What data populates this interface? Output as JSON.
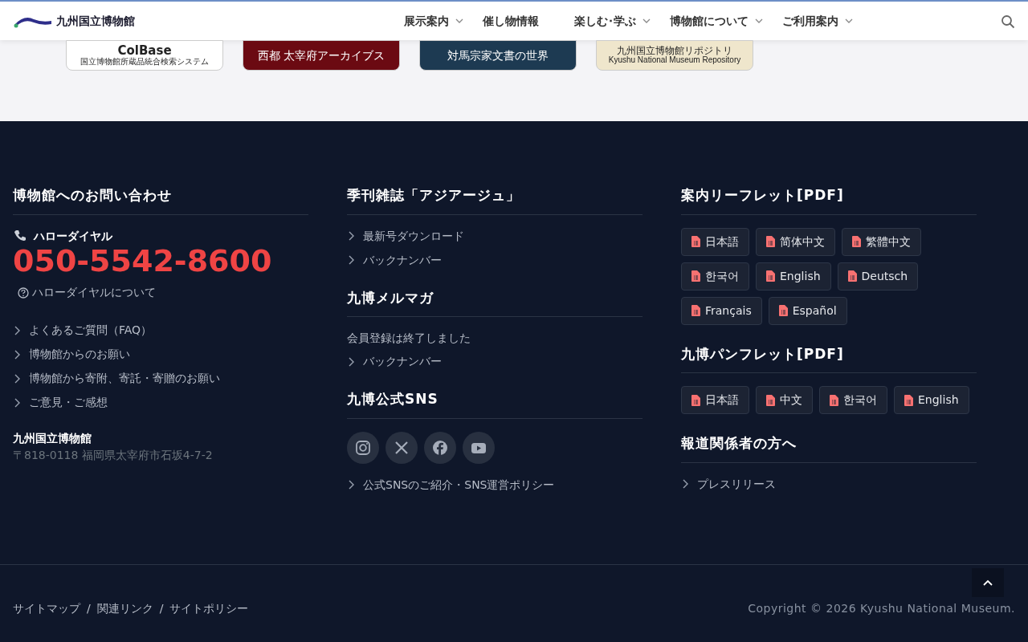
{
  "header": {
    "logo_text": "九州国立博物館",
    "nav": [
      {
        "label": "展示案内",
        "has_menu": true
      },
      {
        "label": "催し物情報",
        "has_menu": false
      },
      {
        "label": "楽しむ･学ぶ",
        "has_menu": true
      },
      {
        "label": "博物館について",
        "has_menu": true
      },
      {
        "label": "ご利用案内",
        "has_menu": true
      }
    ]
  },
  "banners": [
    {
      "lines": [
        "ColBase",
        "国立博物館所蔵品統合検索システム"
      ],
      "color": "#ffffff"
    },
    {
      "lines": [
        "西都 太宰府アーカイブス"
      ],
      "color": "#6b0a12"
    },
    {
      "lines": [
        "対馬宗家文書の世界"
      ],
      "color": "#1d3a52"
    },
    {
      "lines": [
        "九州国立博物館リポジトリ",
        "Kyushu National Museum Repository"
      ],
      "color": "#efe6cc"
    }
  ],
  "footer": {
    "columns": [
      {
        "sections": [
          {
            "title": "博物館へのお問い合わせ",
            "blocks": [
              {
                "kind": "phone",
                "label": "ハローダイヤル",
                "number": "050-5542-8600",
                "help": "ハローダイヤルについて"
              },
              {
                "kind": "links",
                "items": [
                  "よくあるご質問（FAQ）",
                  "博物館からのお願い",
                  "博物館から寄附、寄託・寄贈のお願い",
                  "ご意見・ご感想"
                ]
              },
              {
                "kind": "address",
                "name": "九州国立博物館",
                "text": "〒818-0118 福岡県太宰府市石坂4-7-2"
              }
            ]
          }
        ]
      },
      {
        "sections": [
          {
            "title": "季刊雑誌「アジアージュ」",
            "blocks": [
              {
                "kind": "links",
                "items": [
                  "最新号ダウンロード",
                  "バックナンバー"
                ]
              }
            ]
          },
          {
            "title": "九博メルマガ",
            "blocks": [
              {
                "kind": "note",
                "text": "会員登録は終了しました"
              },
              {
                "kind": "links",
                "items": [
                  "バックナンバー"
                ]
              }
            ]
          },
          {
            "title": "九博公式SNS",
            "blocks": [
              {
                "kind": "social",
                "items": [
                  {
                    "kind": "instagram"
                  },
                  {
                    "kind": "x"
                  },
                  {
                    "kind": "facebook"
                  },
                  {
                    "kind": "youtube"
                  }
                ]
              },
              {
                "kind": "links",
                "items": [
                  "公式SNSのご紹介・SNS運営ポリシー"
                ]
              }
            ]
          }
        ]
      },
      {
        "sections": [
          {
            "title": "案内リーフレット[PDF]",
            "blocks": [
              {
                "kind": "pdfs",
                "items": [
                  "日本語",
                  "简体中文",
                  "繁體中文",
                  "한국어",
                  "English",
                  "Deutsch",
                  "Français",
                  "Español"
                ]
              }
            ]
          },
          {
            "title": "九博パンフレット[PDF]",
            "blocks": [
              {
                "kind": "pdfs",
                "items": [
                  "日本語",
                  "中文",
                  "한국어",
                  "English"
                ]
              }
            ]
          },
          {
            "title": "報道関係者の方へ",
            "blocks": [
              {
                "kind": "links",
                "items": [
                  "プレスリリース"
                ]
              }
            ]
          }
        ]
      }
    ]
  },
  "bottom": {
    "links": [
      "サイトマップ",
      "関連リンク",
      "サイトポリシー"
    ],
    "separator": "/",
    "copyright": "Copyright © 2026 Kyushu National Museum."
  }
}
